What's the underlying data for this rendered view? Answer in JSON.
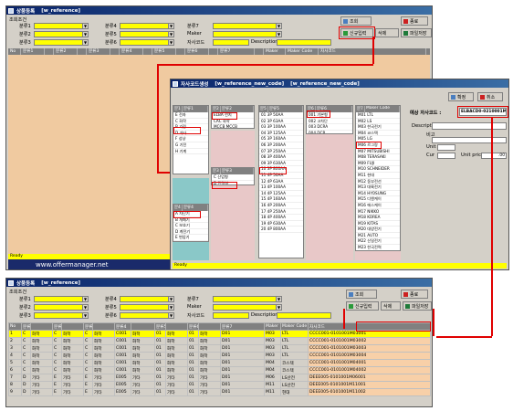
{
  "win1": {
    "title": "상품등록",
    "title_code": "[w_reference]",
    "section": "조회조건",
    "filters": {
      "cat1": "분류1",
      "cat2": "분류2",
      "cat3": "분류3",
      "cat4": "분류4",
      "cat5": "분류5",
      "cat6": "분류6",
      "cat7": "분류7",
      "maker": "Maker",
      "code": "자사코드",
      "description": "Description"
    },
    "buttons": {
      "search": "조회",
      "new": "신규입력",
      "delete": "삭제",
      "excel": "파일저장",
      "close": "종료"
    },
    "columns": [
      "No",
      "분류1",
      "",
      "분류2",
      "",
      "분류3",
      "",
      "분류4",
      "",
      "분류5",
      "",
      "분류6",
      "",
      "분류7",
      "",
      "Maker",
      "Maker Code",
      "자사코드"
    ],
    "status": "Ready",
    "footer": "www.offermanager.net"
  },
  "win2": {
    "title": "자사코드생성",
    "title_code": "[w_reference_new_code]",
    "title_code2": "[w_reference_new_code]",
    "buttons": {
      "confirm": "확정",
      "cancel": "취소"
    },
    "code_label": "예상 자사코드 :",
    "code_value": "ELBACD0-0210001M11",
    "form": {
      "description": "Description",
      "remark": "비고",
      "unit": "Unit",
      "cur": "Cur",
      "unit_price": "Unit price",
      "unit_price_value": ".00"
    },
    "col1": {
      "headers": [
        "분1",
        "분류1"
      ],
      "rows": [
        "E  전자",
        "C  화학",
        "B  기전",
        "D  기타",
        "F  성냥",
        "G  기전",
        "H  기계"
      ]
    },
    "col2": {
      "headers": [
        "분2",
        "분류2"
      ],
      "rows": [
        "ELBA  전지",
        "CAC  화학",
        "MCCB  MCCB"
      ]
    },
    "col3": {
      "headers": [
        "분3",
        "분류3"
      ],
      "rows": [
        "C  산업형",
        "D  전력형"
      ]
    },
    "col4": {
      "headers": [
        "분4",
        "분류4"
      ],
      "rows": [
        "A  차단기",
        "B  개폐기",
        "C  보호기",
        "D  계전기",
        "E  변압기"
      ]
    },
    "col5": {
      "headers": [
        "분5",
        "분류5"
      ],
      "rows": [
        "01  3P 50AA",
        "02  3P 63AA",
        "03  3P 100AA",
        "04  3P 125AA",
        "05  3P 160AA",
        "06  3P 200AA",
        "07  3P 250AA",
        "08  3P 400AA",
        "09  3P 630AA",
        "10  3P 800AA",
        "11  4P 50AA",
        "12  4P 63AA",
        "13  4P 100AA",
        "14  4P 125AA",
        "15  4P 160AA",
        "16  4P 200AA",
        "17  4P 250AA",
        "18  4P 400AA",
        "19  4P 630AA",
        "20  4P 800AA"
      ]
    },
    "col6": {
      "headers": [
        "분6",
        "분류6"
      ],
      "rows": [
        "001  기본형",
        "002  고차단",
        "003  DCRA",
        "004  DCR"
      ]
    },
    "col7": {
      "headers": [
        "분7",
        "Maker Code"
      ],
      "rows": [
        "M01  LTL",
        "M02  LS",
        "M03  한국전기",
        "M04  코스텍",
        "M05  LG",
        "M06  르그랑",
        "M07  MITSUBISHI",
        "M08  TERASAKI",
        "M09  FUJI",
        "M10  SCHNEIDER",
        "M11  현대",
        "M12  동부전선",
        "M13  대륙전기",
        "M14  HYOSUNG",
        "M15  디엔케이",
        "M16  에스케이",
        "M17  NIKKO",
        "M18  KOREA",
        "M19  KITAS",
        "M20  대양전기",
        "M21  AUTO",
        "M22  신일전기",
        "M23  한국전력"
      ]
    },
    "status": "Ready"
  },
  "win3": {
    "title": "상품등록",
    "title_code": "[w_reference]",
    "section": "조회조건",
    "filters": {
      "cat1": "분류1",
      "cat2": "분류2",
      "cat3": "분류3",
      "cat4": "분류4",
      "cat5": "분류5",
      "cat6": "분류6",
      "cat7": "분류7",
      "maker": "Maker",
      "code": "자사코드",
      "description": "Description"
    },
    "buttons": {
      "search": "조회",
      "new": "신규입력",
      "delete": "삭제",
      "excel": "파일저장",
      "close": "종료"
    },
    "columns": [
      "No",
      "분류1",
      "",
      "분류2",
      "",
      "분류3",
      "",
      "분류4",
      "",
      "분류5",
      "",
      "분류6",
      "",
      "분류7",
      "Maker",
      "Maker Code",
      "자사코드"
    ],
    "rows": [
      [
        "1",
        "C",
        "화학",
        "C",
        "화학",
        "C",
        "화학",
        "C001",
        "화학",
        "01",
        "화학",
        "01",
        "화학",
        "D01",
        "M03",
        "LTL",
        "CCCC001-0101001M03001"
      ],
      [
        "2",
        "C",
        "화학",
        "C",
        "화학",
        "C",
        "화학",
        "C001",
        "화학",
        "01",
        "화학",
        "01",
        "화학",
        "D01",
        "M03",
        "LTL",
        "CCCC001-0101001M03002"
      ],
      [
        "3",
        "C",
        "화학",
        "C",
        "화학",
        "C",
        "화학",
        "C001",
        "화학",
        "01",
        "화학",
        "01",
        "화학",
        "D01",
        "M03",
        "LTL",
        "CCCC001-0101001M03003"
      ],
      [
        "4",
        "C",
        "화학",
        "C",
        "화학",
        "C",
        "화학",
        "C001",
        "화학",
        "01",
        "화학",
        "01",
        "화학",
        "D01",
        "M03",
        "LTL",
        "CCCC001-0101001M03004"
      ],
      [
        "5",
        "C",
        "화학",
        "C",
        "화학",
        "C",
        "화학",
        "C001",
        "화학",
        "01",
        "화학",
        "01",
        "화학",
        "D01",
        "M04",
        "코스텍",
        "CCCC001-0101001M04001"
      ],
      [
        "6",
        "C",
        "화학",
        "C",
        "화학",
        "C",
        "화학",
        "C001",
        "화학",
        "01",
        "화학",
        "01",
        "화학",
        "D01",
        "M04",
        "코스텍",
        "CCCC001-0101001M04002"
      ],
      [
        "7",
        "D",
        "기타",
        "E",
        "기타",
        "E",
        "기타",
        "E005",
        "기타",
        "01",
        "기타",
        "01",
        "기타",
        "D01",
        "M06",
        "LS산전",
        "DEEE005-0101001M06001"
      ],
      [
        "8",
        "D",
        "기타",
        "E",
        "기타",
        "E",
        "기타",
        "E005",
        "기타",
        "01",
        "기타",
        "01",
        "기타",
        "D01",
        "M11",
        "LS산전",
        "DEEE005-0101001M11001"
      ],
      [
        "9",
        "D",
        "기타",
        "E",
        "기타",
        "E",
        "기타",
        "E005",
        "기타",
        "01",
        "기타",
        "01",
        "기타",
        "D01",
        "M11",
        "현대",
        "DEEE005-0101001M11002"
      ]
    ]
  }
}
